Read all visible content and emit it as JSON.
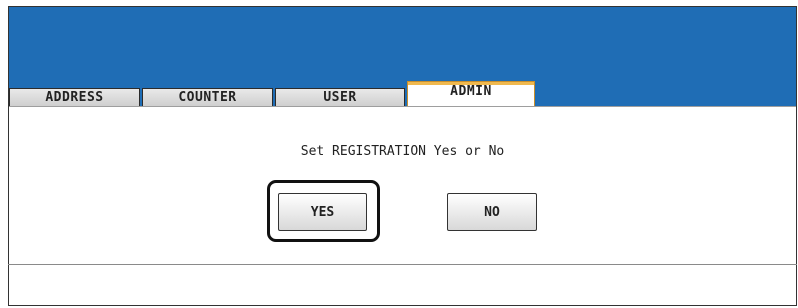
{
  "tabs": [
    {
      "label": "ADDRESS",
      "active": false
    },
    {
      "label": "COUNTER",
      "active": false
    },
    {
      "label": "USER",
      "active": false
    },
    {
      "label": "ADMIN",
      "active": true
    }
  ],
  "dialog": {
    "prompt": "Set REGISTRATION Yes or No",
    "yes_label": "YES",
    "no_label": "NO"
  },
  "colors": {
    "header": "#1f6db5",
    "active_tab_accent": "#f0b94f"
  }
}
